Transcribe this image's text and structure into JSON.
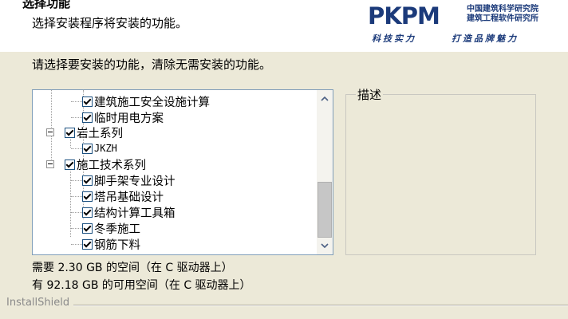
{
  "header": {
    "title": "选择功能",
    "subtitle": "选择安装程序将安装的功能。",
    "logo_mark": "PKPM",
    "logo_org_line1": "中国建筑科学研究院",
    "logo_org_line2": "建筑工程软件研究所",
    "slogan_left": "科技实力",
    "slogan_right": "打造品牌魅力"
  },
  "instruction": "请选择要安装的功能，清除无需安装的功能。",
  "tree": {
    "items": [
      {
        "label": "建筑施工安全设施计算",
        "checked": true
      },
      {
        "label": "临时用电方案",
        "checked": true
      },
      {
        "label": "岩土系列",
        "checked": true
      },
      {
        "label": "JKZH",
        "checked": true
      },
      {
        "label": "施工技术系列",
        "checked": true
      },
      {
        "label": "脚手架专业设计",
        "checked": true
      },
      {
        "label": "塔吊基础设计",
        "checked": true
      },
      {
        "label": "结构计算工具箱",
        "checked": true
      },
      {
        "label": "冬季施工",
        "checked": true
      },
      {
        "label": "钢筋下料",
        "checked": true
      }
    ],
    "scroll_position": 0.6
  },
  "description": {
    "label": "描述"
  },
  "space": {
    "required": "需要 2.30 GB 的空间（在 C 驱动器上）",
    "available": "有 92.18 GB 的可用空间（在 C 驱动器上）"
  },
  "footer": {
    "brand": "InstallShield"
  }
}
